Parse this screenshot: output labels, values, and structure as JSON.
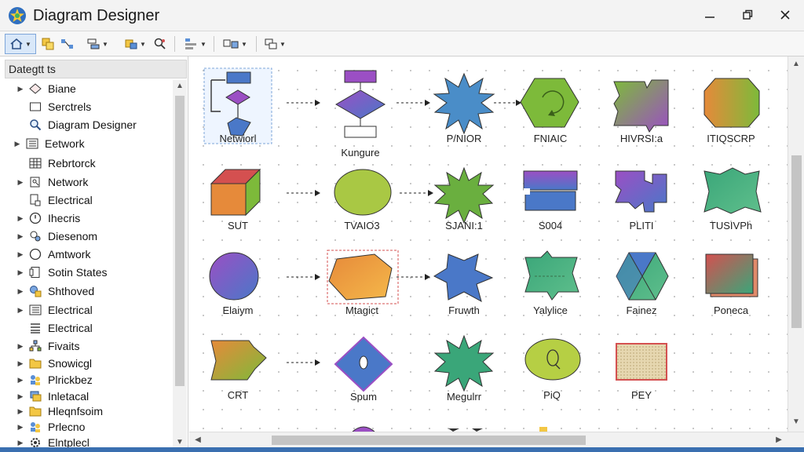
{
  "window": {
    "title": "Diagram Designer"
  },
  "sidebar": {
    "header": "Dategtt ts",
    "items": [
      {
        "label": "Biane",
        "icon": "diamond-icon",
        "expander": true
      },
      {
        "label": "Serctrels",
        "icon": "rectangle-icon",
        "expander": false
      },
      {
        "label": "Diagram Designer",
        "icon": "magnifier-icon",
        "expander": false
      },
      {
        "label": "Eetwork",
        "icon": "list-icon",
        "expander": true
      },
      {
        "label": "Rebrtorck",
        "icon": "grid-icon",
        "expander": false
      },
      {
        "label": "Network",
        "icon": "network-icon",
        "expander": true
      },
      {
        "label": "Electrical",
        "icon": "electrical-icon",
        "expander": false
      },
      {
        "label": "Ihecris",
        "icon": "clock-icon",
        "expander": true
      },
      {
        "label": "Diesenom",
        "icon": "gear-user-icon",
        "expander": true
      },
      {
        "label": "Amtwork",
        "icon": "circle-icon",
        "expander": true
      },
      {
        "label": "Sotin States",
        "icon": "document-icon",
        "expander": true
      },
      {
        "label": "Shthoved",
        "icon": "shapes-icon",
        "expander": true
      },
      {
        "label": "Electrical",
        "icon": "list-icon",
        "expander": true
      },
      {
        "label": "Electrical",
        "icon": "list-icon",
        "expander": false
      },
      {
        "label": "Fivaits",
        "icon": "hierarchy-icon",
        "expander": true
      },
      {
        "label": "Snowicgl",
        "icon": "folder-icon",
        "expander": true
      },
      {
        "label": "Plrickbez",
        "icon": "people-icon",
        "expander": true
      },
      {
        "label": "Inletacal",
        "icon": "stack-icon",
        "expander": true
      },
      {
        "label": "Hleqnfsoim",
        "icon": "folder-icon",
        "expander": true
      },
      {
        "label": "Prlecno",
        "icon": "people-icon",
        "expander": true
      },
      {
        "label": "Elntplecl",
        "icon": "gear-icon",
        "expander": true
      }
    ]
  },
  "canvas": {
    "shapes": [
      {
        "label": "Netwiorl",
        "name": "flowchart-shape"
      },
      {
        "label": "Kungure",
        "name": "process-shape"
      },
      {
        "label": "P/NIOR",
        "name": "starburst-shape"
      },
      {
        "label": "FNIAIC",
        "name": "cycle-hexagon-shape"
      },
      {
        "label": "HIVRSI:a",
        "name": "notched-shape"
      },
      {
        "label": "ITIQSCRP",
        "name": "octagon-shape"
      },
      {
        "label": "SUT",
        "name": "cube-shape"
      },
      {
        "label": "TVAIO3",
        "name": "ellipse-shape"
      },
      {
        "label": "SJANI:1",
        "name": "starburst-green-shape"
      },
      {
        "label": "S004",
        "name": "banner-shape"
      },
      {
        "label": "PLITI",
        "name": "puzzle-shape"
      },
      {
        "label": "TUSIVPh",
        "name": "wave-rectangle-shape"
      },
      {
        "label": "Elaiym",
        "name": "circle-shape"
      },
      {
        "label": "Mtagict",
        "name": "pentagon-shape"
      },
      {
        "label": "Fruwth",
        "name": "irregular-star-shape"
      },
      {
        "label": "Yalylice",
        "name": "arrow-box-shape"
      },
      {
        "label": "Fainez",
        "name": "hexagon-x-shape"
      },
      {
        "label": "Poneca",
        "name": "stacked-square-shape"
      },
      {
        "label": "CRT",
        "name": "arrow-pentagon-shape"
      },
      {
        "label": "Spum",
        "name": "diamond-shape"
      },
      {
        "label": "Megulrr",
        "name": "starburst-teal-shape"
      },
      {
        "label": "PiQ",
        "name": "ellipse-q-shape"
      },
      {
        "label": "PEY",
        "name": "texture-rectangle-shape"
      }
    ]
  },
  "colors": {
    "accent": "#3a6fb0",
    "blue": "#4a78c8",
    "green": "#7dba3a",
    "purple": "#9b4fc4",
    "orange": "#e68a3a",
    "teal": "#3aa679",
    "red": "#d45050"
  }
}
